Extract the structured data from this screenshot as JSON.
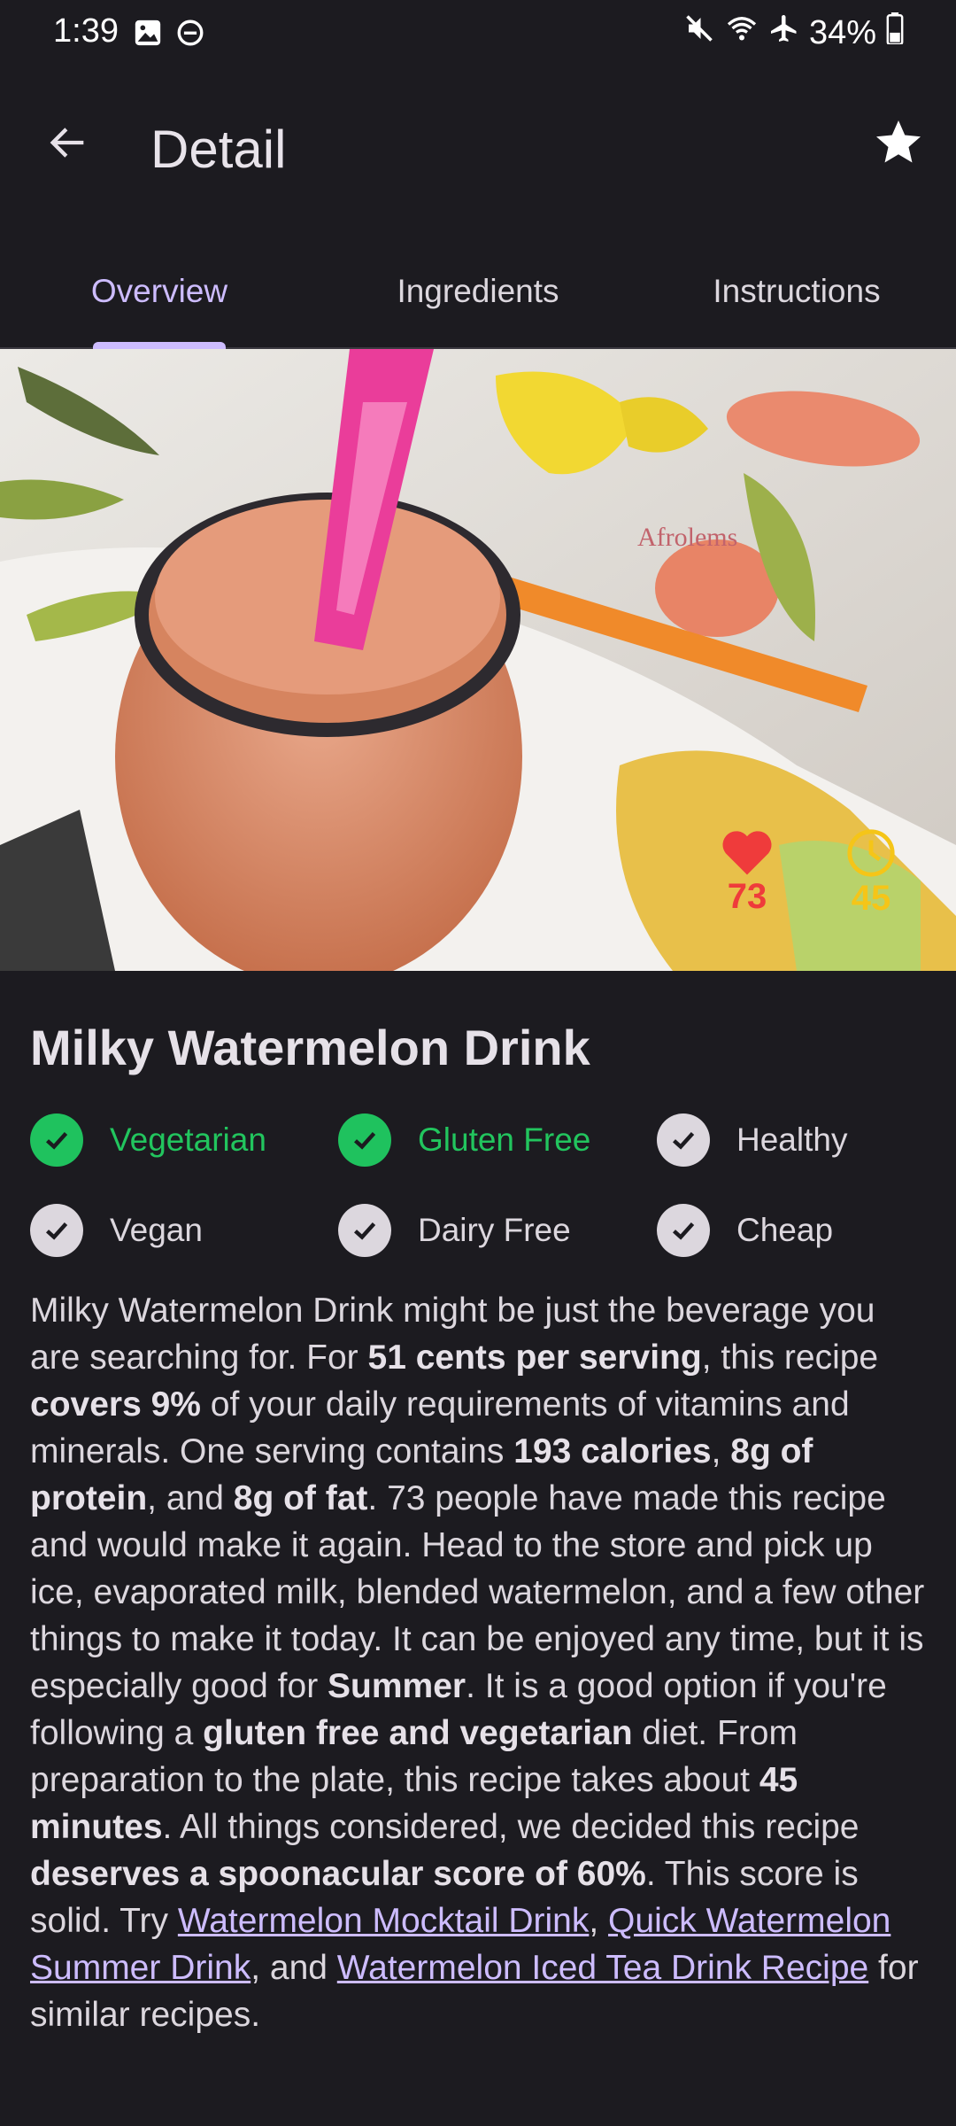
{
  "status_bar": {
    "time": "1:39",
    "battery": "34%",
    "icons": [
      "image-icon",
      "dnd-icon",
      "mute-icon",
      "wifi-icon",
      "airplane-icon",
      "battery-icon"
    ]
  },
  "app_bar": {
    "title": "Detail",
    "back_icon": "arrow-left-icon",
    "favorite_icon": "star-icon"
  },
  "tabs": [
    {
      "label": "Overview",
      "active": true
    },
    {
      "label": "Ingredients",
      "active": false
    },
    {
      "label": "Instructions",
      "active": false
    }
  ],
  "hero": {
    "watermark": "Afrolems",
    "likes": "73",
    "minutes": "45",
    "likes_color": "#ef3b3b",
    "time_color": "#f5c518"
  },
  "recipe": {
    "title": "Milky Watermelon Drink",
    "tags": [
      {
        "label": "Vegetarian",
        "active": true
      },
      {
        "label": "Gluten Free",
        "active": true
      },
      {
        "label": "Healthy",
        "active": false
      },
      {
        "label": "Vegan",
        "active": false
      },
      {
        "label": "Dairy Free",
        "active": false
      },
      {
        "label": "Cheap",
        "active": false
      }
    ],
    "description": {
      "p1": "Milky Watermelon Drink might be just the beverage you are searching for. For ",
      "b1": "51 cents per serving",
      "p2": ", this recipe ",
      "b2": "covers 9%",
      "p3": " of your daily requirements of vitamins and minerals. One serving contains ",
      "b3": "193 calories",
      "p4": ", ",
      "b4": "8g of protein",
      "p5": ", and ",
      "b5": "8g of fat",
      "p6": ". 73 people have made this recipe and would make it again. Head to the store and pick up ice, evaporated milk, blended watermelon, and a few other things to make it today. It can be enjoyed any time, but it is especially good for ",
      "b6": "Summer",
      "p7": ". It is a good option if you're following a ",
      "b7": "gluten free and vegetarian",
      "p8": " diet. From preparation to the plate, this recipe takes about ",
      "b8": "45 minutes",
      "p9": ". All things considered, we decided this recipe ",
      "b9": "deserves a spoonacular score of 60%",
      "p10": ". This score is solid. Try ",
      "l1": "Watermelon Mocktail Drink",
      "p11": ", ",
      "l2": "Quick Watermelon Summer Drink",
      "p12": ", and ",
      "l3": "Watermelon Iced Tea Drink Recipe",
      "p13": " for similar recipes."
    }
  }
}
